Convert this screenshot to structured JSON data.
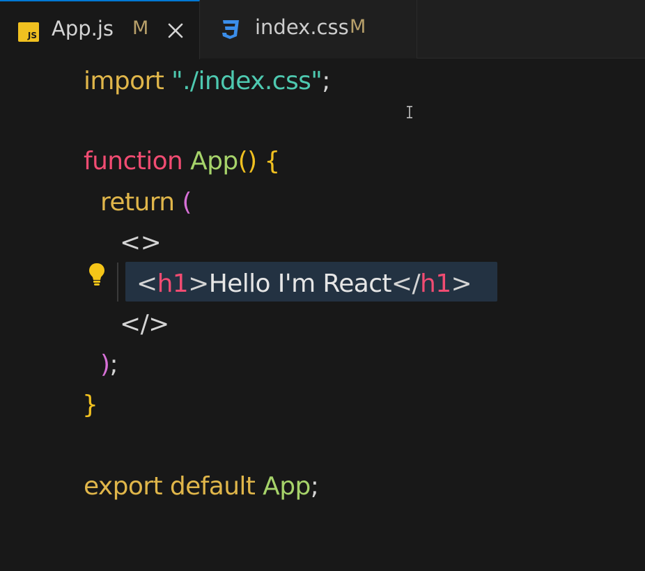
{
  "tabs": [
    {
      "label": "App.js",
      "badge": "M",
      "icon": "js-file-icon",
      "active": true
    },
    {
      "label": "index.css",
      "badge": "M",
      "icon": "css-file-icon",
      "active": false
    }
  ],
  "js_icon_text": "JS",
  "code": {
    "line1": {
      "kw": "import",
      "str": "\"./index.css\"",
      "end": ";"
    },
    "line3": {
      "kw": "function",
      "name": "App",
      "parens": "()",
      "brace": "{"
    },
    "line4": {
      "kw": "return",
      "paren": "("
    },
    "line5": {
      "frag": "<>"
    },
    "line6": {
      "open_lt": "<",
      "open_tag": "h1",
      "open_gt": ">",
      "text": "Hello I'm React",
      "close_lt": "</",
      "close_tag": "h1",
      "close_gt": ">"
    },
    "line7": {
      "frag": "</>"
    },
    "line8": {
      "paren": ")",
      "end": ";"
    },
    "line9": {
      "brace": "}"
    },
    "line11": {
      "kw": "export default",
      "name": "App",
      "end": ";"
    }
  },
  "colors": {
    "accent": "#0078d4",
    "keyword_pink": "#f14c72",
    "keyword_gold": "#e0b64a",
    "string_teal": "#4ec9b0",
    "function_green": "#a6d36a",
    "bracket_purple": "#d670d6",
    "selection": "#233242"
  }
}
